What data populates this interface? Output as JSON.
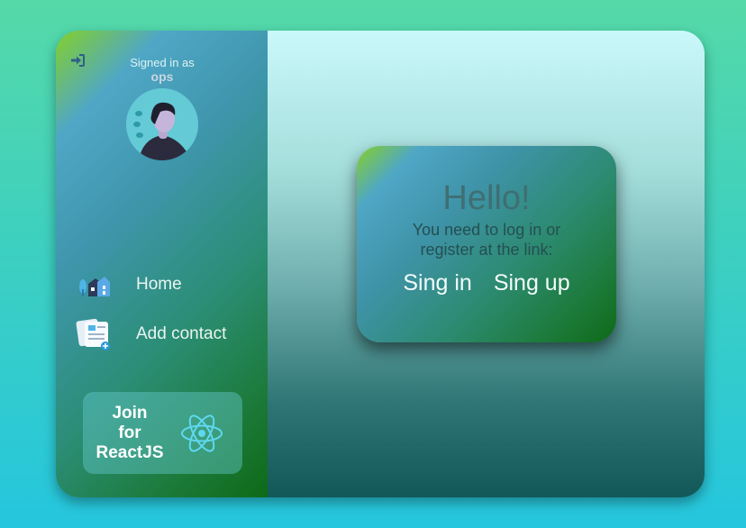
{
  "sidebar": {
    "signed_in_label": "Signed in as",
    "username": "ops",
    "nav": [
      {
        "label": "Home",
        "icon": "home-icon"
      },
      {
        "label": "Add contact",
        "icon": "contacts-icon"
      }
    ],
    "promo": {
      "line1": "Join",
      "line2": "for",
      "line3": "ReactJS",
      "icon": "react-icon"
    }
  },
  "main": {
    "card": {
      "title": "Hello!",
      "message": "You need to log in or register at the link:",
      "signin_label": "Sing in",
      "signup_label": "Sing up"
    }
  },
  "colors": {
    "accent_green": "#1c7a3a",
    "accent_blue": "#4fa7c6",
    "background_top": "#55d9a8",
    "background_bottom": "#25c6de"
  }
}
